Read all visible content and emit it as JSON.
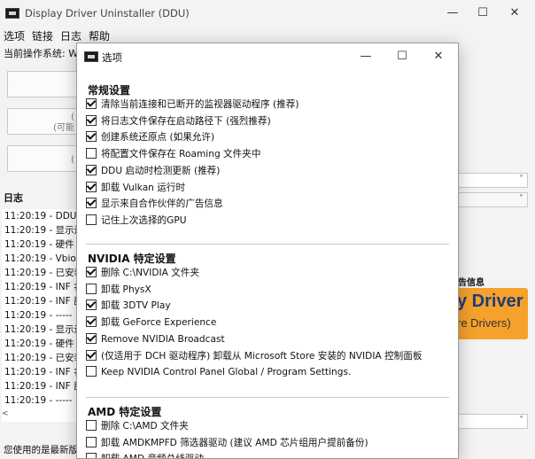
{
  "main": {
    "title": "Display Driver Uninstaller (DDU)",
    "caption": {
      "minimize": "—",
      "maximize": "☐",
      "close": "✕"
    },
    "menu": [
      "选项",
      "链接",
      "日志",
      "帮助"
    ],
    "os_label": "当前操作系统: W",
    "buttons": [
      {
        "line1": "",
        "line2": ""
      },
      {
        "line1": "(",
        "line2": "(可能"
      },
      {
        "line1": "(",
        "line2": ""
      }
    ],
    "log_label": "日志",
    "log_lines": [
      "11:20:19 - DDU",
      "11:20:19 - 显示运",
      "11:20:19 - 硬件 I",
      "11:20:19 - Vbios",
      "11:20:19 - 已安装",
      "11:20:19 - INF 名",
      "11:20:19 - INF 部",
      "11:20:19 - -----",
      "11:20:19 - 显示运",
      "11:20:19 - 硬件 I",
      "11:20:19 - 已安装",
      "11:20:19 - INF 名",
      "11:20:19 - INF 部",
      "11:20:19 - -----"
    ],
    "scroll_left": "<",
    "status": "您使用的是最新版",
    "ad_header": "告信息",
    "ad_line1": "y Driver",
    "ad_line2": "re Drivers)",
    "dropdown_chevron": "˅"
  },
  "dialog": {
    "title": "选项",
    "caption": {
      "minimize": "—",
      "maximize": "☐",
      "close": "✕"
    },
    "sections": [
      {
        "title": "常规设置",
        "options": [
          {
            "label": "清除当前连接和已断开的监视器驱动程序 (推荐)",
            "checked": true
          },
          {
            "label": "将日志文件保存在启动路径下 (强烈推荐)",
            "checked": true
          },
          {
            "label": "创建系统还原点 (如果允许)",
            "checked": true
          },
          {
            "label": "将配置文件保存在 Roaming 文件夹中",
            "checked": false
          },
          {
            "label": "DDU 启动时检测更新 (推荐)",
            "checked": true
          },
          {
            "label": "卸载 Vulkan 运行时",
            "checked": true
          },
          {
            "label": "显示来自合作伙伴的广告信息",
            "checked": true
          },
          {
            "label": "记住上次选择的GPU",
            "checked": false
          }
        ]
      },
      {
        "title": "NVIDIA 特定设置",
        "options": [
          {
            "label": "删除 C:\\NVIDIA 文件夹",
            "checked": true
          },
          {
            "label": "卸载 PhysX",
            "checked": false
          },
          {
            "label": "卸载 3DTV Play",
            "checked": true
          },
          {
            "label": "卸载 GeForce Experience",
            "checked": true
          },
          {
            "label": "Remove NVIDIA Broadcast",
            "checked": true
          },
          {
            "label": "(仅适用于 DCH 驱动程序) 卸载从 Microsoft Store 安装的 NVIDIA 控制面板",
            "checked": true
          },
          {
            "label": "Keep NVIDIA Control Panel Global / Program Settings.",
            "checked": false
          }
        ]
      },
      {
        "title": "AMD 特定设置",
        "options": [
          {
            "label": "删除 C:\\AMD 文件夹",
            "checked": false
          },
          {
            "label": "卸载 AMDKMPFD 筛选器驱动 (建议 AMD 芯片组用户提前备份)",
            "checked": false
          },
          {
            "label": "卸载 AMD 音频总线驱动",
            "checked": false
          }
        ]
      }
    ]
  }
}
